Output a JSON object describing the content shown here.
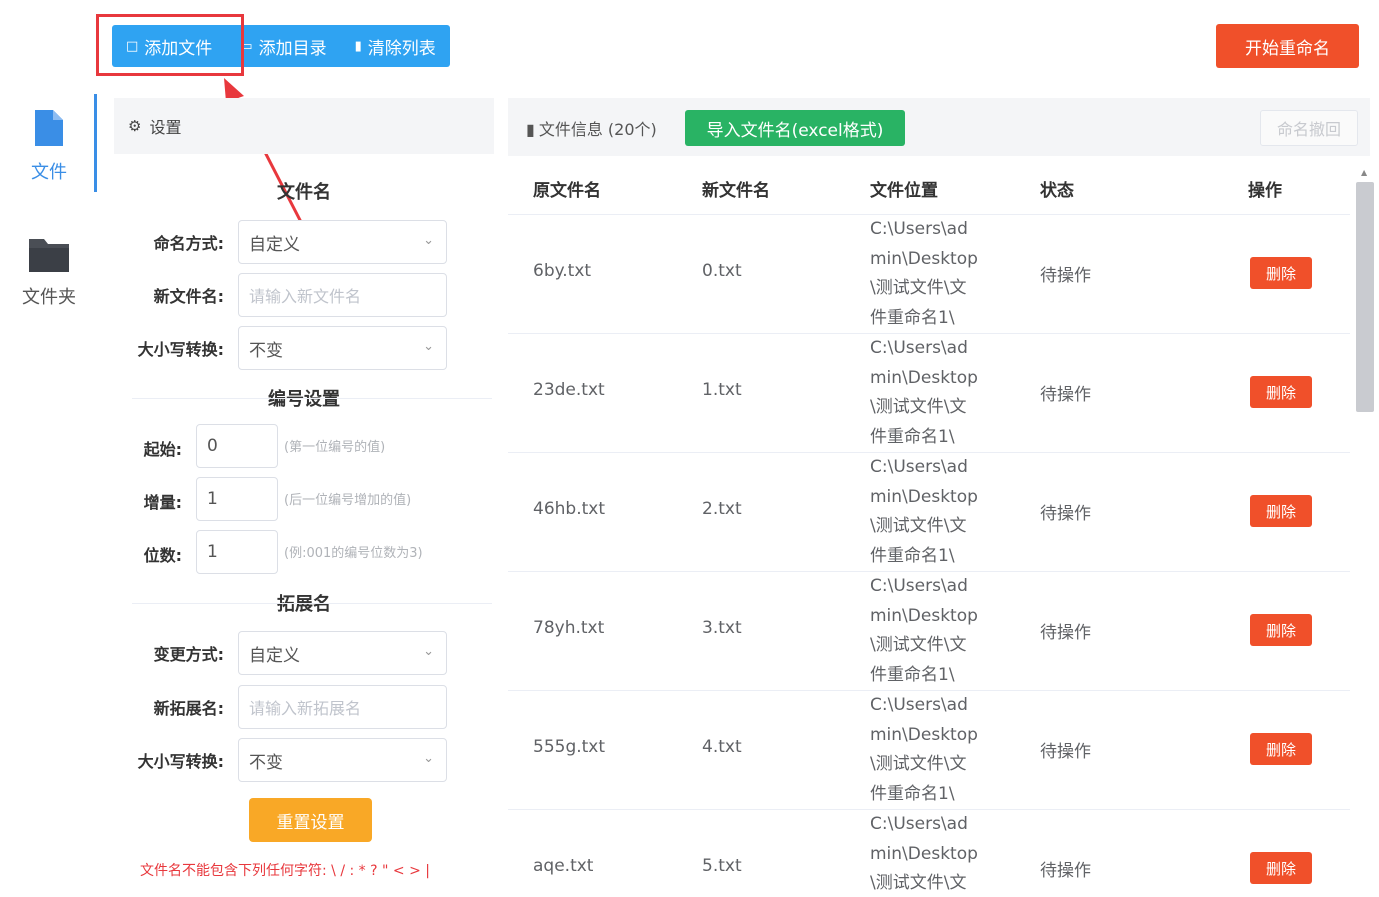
{
  "toolbar": {
    "add_file": "添加文件",
    "add_dir": "添加目录",
    "clear_list": "清除列表",
    "start_rename": "开始重命名"
  },
  "nav": {
    "file": "文件",
    "folder": "文件夹"
  },
  "settings": {
    "title": "设置",
    "filename_section": "文件名",
    "naming_mode_label": "命名方式:",
    "naming_mode_value": "自定义",
    "new_name_label": "新文件名:",
    "new_name_placeholder": "请输入新文件名",
    "case_label": "大小写转换:",
    "case_value": "不变",
    "numbering_section": "编号设置",
    "start_label": "起始:",
    "start_value": "0",
    "start_hint": "(第一位编号的值)",
    "step_label": "增量:",
    "step_value": "1",
    "step_hint": "(后一位编号增加的值)",
    "digits_label": "位数:",
    "digits_value": "1",
    "digits_hint": "(例:001的编号位数为3)",
    "ext_section": "拓展名",
    "change_mode_label": "变更方式:",
    "change_mode_value": "自定义",
    "new_ext_label": "新拓展名:",
    "new_ext_placeholder": "请输入新拓展名",
    "ext_case_label": "大小写转换:",
    "ext_case_value": "不变",
    "reset_button": "重置设置",
    "warning": "文件名不能包含下列任何字符: \\ / : * ? \" < > |"
  },
  "fileinfo": {
    "title": "文件信息 (20个)",
    "import_button": "导入文件名(excel格式)",
    "undo_button": "命名撤回",
    "columns": [
      "原文件名",
      "新文件名",
      "文件位置",
      "状态",
      "操作"
    ],
    "delete_label": "删除",
    "rows": [
      {
        "orig": "6by.txt",
        "new": "0.txt",
        "loc": "C:\\Users\\ad\nmin\\Desktop\n\\测试文件\\文\n件重命名1\\",
        "status": "待操作"
      },
      {
        "orig": "23de.txt",
        "new": "1.txt",
        "loc": "C:\\Users\\ad\nmin\\Desktop\n\\测试文件\\文\n件重命名1\\",
        "status": "待操作"
      },
      {
        "orig": "46hb.txt",
        "new": "2.txt",
        "loc": "C:\\Users\\ad\nmin\\Desktop\n\\测试文件\\文\n件重命名1\\",
        "status": "待操作"
      },
      {
        "orig": "78yh.txt",
        "new": "3.txt",
        "loc": "C:\\Users\\ad\nmin\\Desktop\n\\测试文件\\文\n件重命名1\\",
        "status": "待操作"
      },
      {
        "orig": "555g.txt",
        "new": "4.txt",
        "loc": "C:\\Users\\ad\nmin\\Desktop\n\\测试文件\\文\n件重命名1\\",
        "status": "待操作"
      },
      {
        "orig": "aqe.txt",
        "new": "5.txt",
        "loc": "C:\\Users\\ad\nmin\\Desktop\n\\测试文件\\文",
        "status": "待操作"
      }
    ]
  },
  "colors": {
    "primary_blue": "#2fa3f2",
    "start_red": "#f0502a",
    "import_green": "#29b364",
    "reset_orange": "#f9a826",
    "highlight_red": "#e8383d"
  },
  "icons": [
    "file-icon",
    "folder-icon",
    "gear-icon",
    "document-icon",
    "trash-icon",
    "chevron-down-icon",
    "arrow-annotation"
  ]
}
